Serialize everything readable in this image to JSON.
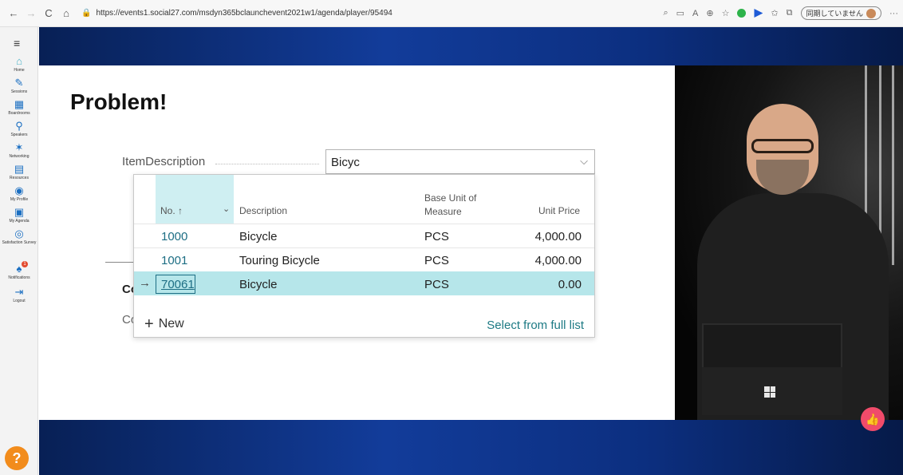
{
  "browser": {
    "back": "←",
    "forward": "→",
    "refresh": "C",
    "home": "⌂",
    "lock": "🔒",
    "url": "https://events1.social27.com/msdyn365bclaunchevent2021w1/agenda/player/95494",
    "sync_label": "同期していません",
    "menu": "···"
  },
  "sidebar": {
    "menu": "≡",
    "items": [
      {
        "icon": "⌂",
        "label": "Home"
      },
      {
        "icon": "✎",
        "label": "Sessions"
      },
      {
        "icon": "▦",
        "label": "Boardrooms"
      },
      {
        "icon": "⚲",
        "label": "Speakers"
      },
      {
        "icon": "✶",
        "label": "Networking"
      },
      {
        "icon": "▤",
        "label": "Resources"
      },
      {
        "icon": "◉",
        "label": "My Profile"
      },
      {
        "icon": "▣",
        "label": "My Agenda"
      },
      {
        "icon": "◎",
        "label": "Satisfaction Survey"
      },
      {
        "icon": "♠",
        "label": "Notifications",
        "badge": "1"
      },
      {
        "icon": "⇥",
        "label": "Logout"
      }
    ],
    "help": "?"
  },
  "slide": {
    "title": "Problem!",
    "field_label": "ItemDescription",
    "field_value": "Bicyc",
    "chevron": "⌵",
    "bg_text_1": "Co",
    "bg_text_2": "Co"
  },
  "lookup": {
    "headers": {
      "no": "No. ↑",
      "chevron": "⌄",
      "description": "Description",
      "unit": "Base Unit of Measure",
      "price": "Unit Price"
    },
    "rows": [
      {
        "no": "1000",
        "description": "Bicycle",
        "unit": "PCS",
        "price": "4,000.00"
      },
      {
        "no": "1001",
        "description": "Touring Bicycle",
        "unit": "PCS",
        "price": "4,000.00"
      },
      {
        "no": "70061",
        "description": "Bicycle",
        "unit": "PCS",
        "price": "0.00"
      }
    ],
    "selected_arrow": "→",
    "new_plus": "+",
    "new_label": "New",
    "full_list_label": "Select from full list"
  },
  "like": "👍",
  "colors": {
    "accent": "#1d7a84",
    "selected_row": "#b6e6ea",
    "sorted_column": "#cfeff2",
    "like": "#f04b6a",
    "help": "#f28c1c"
  }
}
